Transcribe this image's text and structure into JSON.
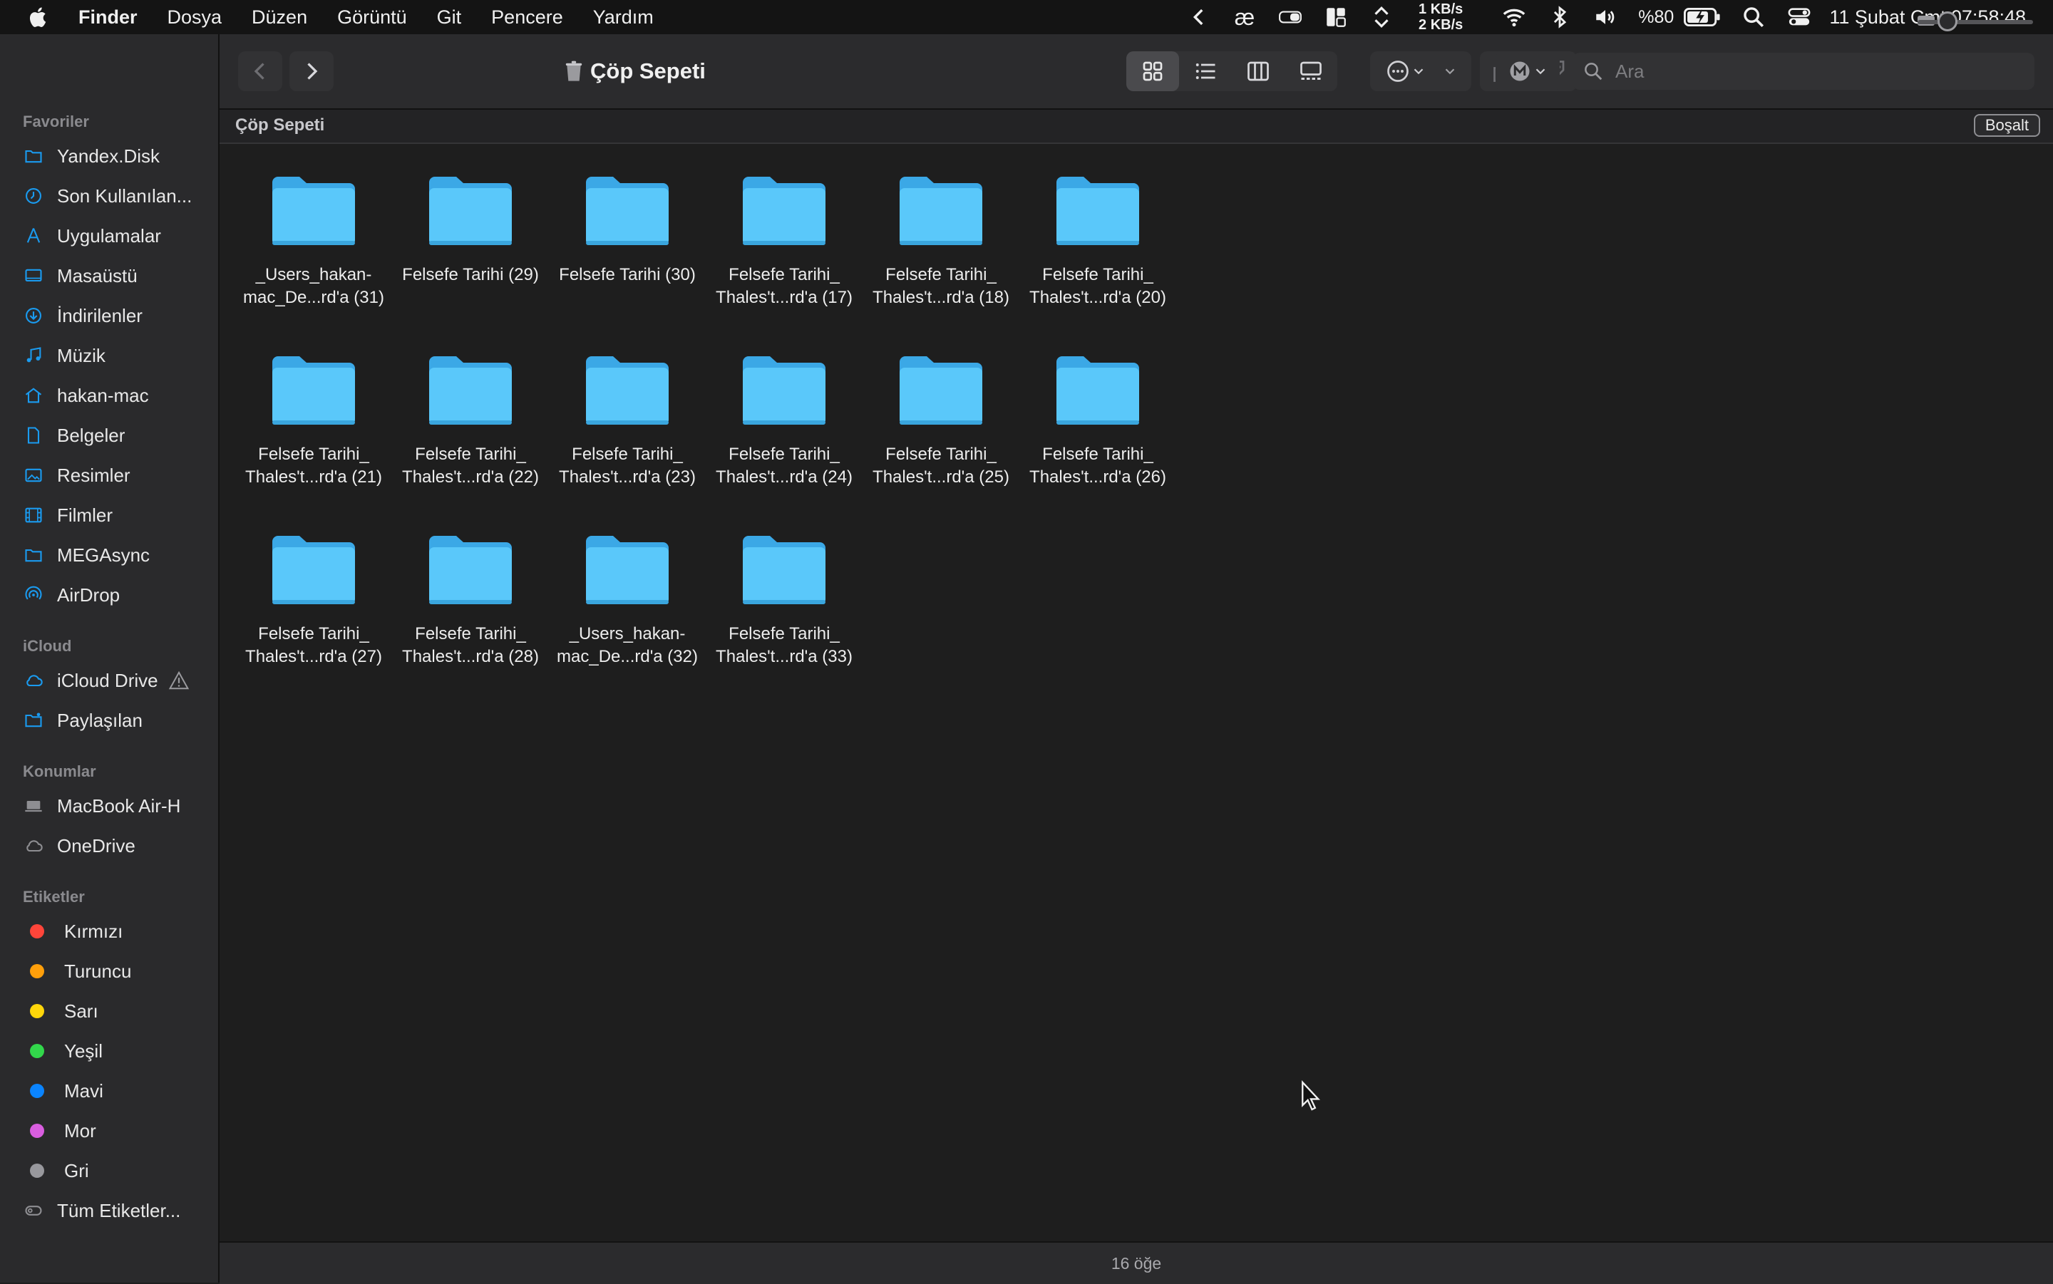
{
  "menubar": {
    "app_name": "Finder",
    "items": [
      "Dosya",
      "Düzen",
      "Görüntü",
      "Git",
      "Pencere",
      "Yardım"
    ],
    "net_up": "1 KB/s",
    "net_down": "2 KB/s",
    "battery": "%80",
    "clock": "11 Şubat Cmt  07:58:48"
  },
  "sidebar": {
    "favorites_title": "Favoriler",
    "favorites": [
      {
        "label": "Yandex.Disk",
        "icon": "folder-icon"
      },
      {
        "label": "Son Kullanılan...",
        "icon": "clock-icon"
      },
      {
        "label": "Uygulamalar",
        "icon": "apps-icon"
      },
      {
        "label": "Masaüstü",
        "icon": "desktop-icon"
      },
      {
        "label": "İndirilenler",
        "icon": "download-icon"
      },
      {
        "label": "Müzik",
        "icon": "music-icon"
      },
      {
        "label": "hakan-mac",
        "icon": "home-icon"
      },
      {
        "label": "Belgeler",
        "icon": "document-icon"
      },
      {
        "label": "Resimler",
        "icon": "photo-icon"
      },
      {
        "label": "Filmler",
        "icon": "film-icon"
      },
      {
        "label": "MEGAsync",
        "icon": "folder-icon"
      },
      {
        "label": "AirDrop",
        "icon": "airdrop-icon"
      }
    ],
    "icloud_title": "iCloud",
    "icloud": [
      {
        "label": "iCloud Drive",
        "icon": "cloud-icon"
      },
      {
        "label": "Paylaşılan",
        "icon": "shared-folder-icon"
      }
    ],
    "locations_title": "Konumlar",
    "locations": [
      {
        "label": "MacBook Air-H",
        "icon": "laptop-icon"
      },
      {
        "label": "OneDrive",
        "icon": "cloud-icon"
      }
    ],
    "tags_title": "Etiketler",
    "tags": [
      {
        "label": "Kırmızı",
        "color": "#ff453a"
      },
      {
        "label": "Turuncu",
        "color": "#ff9f0a"
      },
      {
        "label": "Sarı",
        "color": "#ffd60a"
      },
      {
        "label": "Yeşil",
        "color": "#32d74b"
      },
      {
        "label": "Mavi",
        "color": "#0a84ff"
      },
      {
        "label": "Mor",
        "color": "#d95ee0"
      },
      {
        "label": "Gri",
        "color": "#98989d"
      }
    ],
    "all_tags": "Tüm Etiketler..."
  },
  "toolbar": {
    "title": "Çöp Sepeti",
    "search_placeholder": "Ara"
  },
  "pathbar": {
    "title": "Çöp Sepeti",
    "empty_button": "Boşalt"
  },
  "files": [
    [
      "_Users_hakan-",
      "mac_De...rd'a (31)"
    ],
    [
      "Felsefe Tarihi (29)"
    ],
    [
      "Felsefe Tarihi (30)"
    ],
    [
      "Felsefe Tarihi_",
      "Thales't...rd'a (17)"
    ],
    [
      "Felsefe Tarihi_",
      "Thales't...rd'a (18)"
    ],
    [
      "Felsefe Tarihi_",
      "Thales't...rd'a (20)"
    ],
    [
      "Felsefe Tarihi_",
      "Thales't...rd'a (21)"
    ],
    [
      "Felsefe Tarihi_",
      "Thales't...rd'a (22)"
    ],
    [
      "Felsefe Tarihi_",
      "Thales't...rd'a (23)"
    ],
    [
      "Felsefe Tarihi_",
      "Thales't...rd'a (24)"
    ],
    [
      "Felsefe Tarihi_",
      "Thales't...rd'a (25)"
    ],
    [
      "Felsefe Tarihi_",
      "Thales't...rd'a (26)"
    ],
    [
      "Felsefe Tarihi_",
      "Thales't...rd'a (27)"
    ],
    [
      "Felsefe Tarihi_",
      "Thales't...rd'a (28)"
    ],
    [
      "_Users_hakan-",
      "mac_De...rd'a (32)"
    ],
    [
      "Felsefe Tarihi_",
      "Thales't...rd'a (33)"
    ]
  ],
  "status": {
    "item_count": "16 öğe"
  },
  "colors": {
    "accent": "#1a9bf0",
    "folder": "#5ac8fa"
  }
}
